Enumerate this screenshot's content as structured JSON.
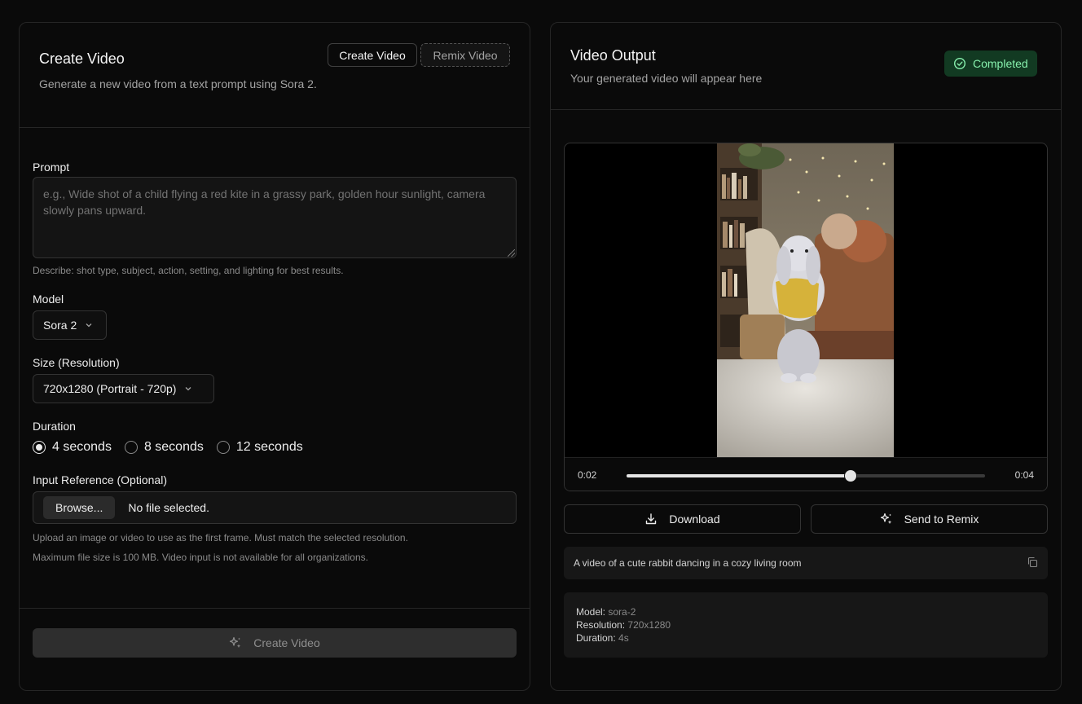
{
  "create_panel": {
    "title": "Create Video",
    "description": "Generate a new video from a text prompt using Sora 2.",
    "mode_tabs": [
      {
        "label": "Create Video",
        "active": true
      },
      {
        "label": "Remix Video",
        "active": false
      }
    ],
    "prompt": {
      "label": "Prompt",
      "value": "",
      "placeholder": "e.g., Wide shot of a child flying a red kite in a grassy park, golden hour sunlight, camera slowly pans upward.",
      "hint": "Describe: shot type, subject, action, setting, and lighting for best results."
    },
    "model": {
      "label": "Model",
      "selected": "Sora 2"
    },
    "size": {
      "label": "Size (Resolution)",
      "selected": "720x1280 (Portrait - 720p)"
    },
    "duration": {
      "label": "Duration",
      "options": [
        {
          "label": "4 seconds",
          "checked": true
        },
        {
          "label": "8 seconds",
          "checked": false
        },
        {
          "label": "12 seconds",
          "checked": false
        }
      ]
    },
    "input_reference": {
      "label": "Input Reference (Optional)",
      "browse_label": "Browse...",
      "status": "No file selected.",
      "hint_1": "Upload an image or video to use as the first frame. Must match the selected resolution.",
      "hint_2": "Maximum file size is 100 MB. Video input is not available for all organizations."
    },
    "submit_label": "Create Video"
  },
  "output_panel": {
    "title": "Video Output",
    "description": "Your generated video will appear here",
    "status_badge": "Completed",
    "player": {
      "current_time": "0:02",
      "duration": "0:04",
      "progress": 0.625
    },
    "download_label": "Download",
    "remix_label": "Send to Remix",
    "prompt_text": "A video of a cute rabbit dancing in a cozy living room",
    "meta": {
      "model_key": "Model:",
      "model_val": "sora-2",
      "resolution_key": "Resolution:",
      "resolution_val": "720x1280",
      "duration_key": "Duration:",
      "duration_val": "4s"
    }
  },
  "colors": {
    "background": "#0a0a0a",
    "border": "#262626",
    "success_bg": "#123a22",
    "success_text": "#86efac"
  },
  "icons": [
    "chevron-down-icon",
    "sparkles-icon",
    "check-circle-icon",
    "download-icon",
    "copy-icon"
  ]
}
